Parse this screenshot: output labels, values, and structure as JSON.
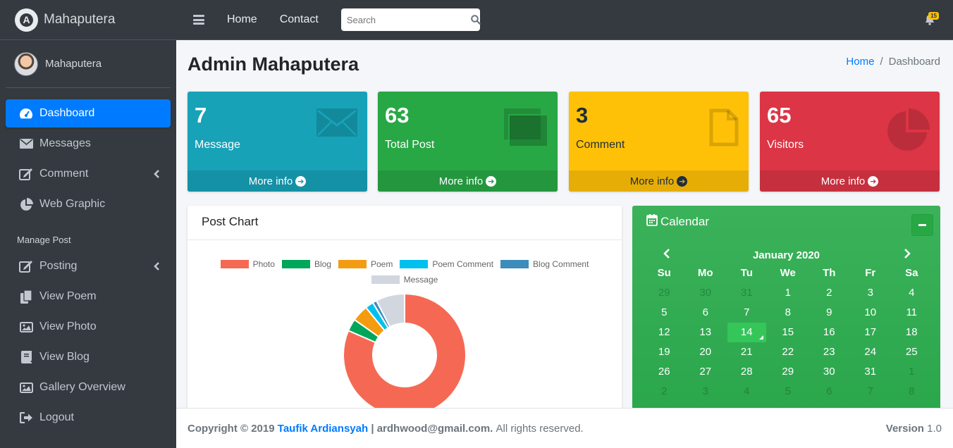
{
  "brand": {
    "name": "Mahaputera",
    "logo_letter": "A"
  },
  "user": {
    "name": "Mahaputera"
  },
  "sidebar": {
    "items": [
      {
        "label": "Dashboard",
        "icon": "dashboard-icon",
        "active": true
      },
      {
        "label": "Messages",
        "icon": "envelope-icon"
      },
      {
        "label": "Comment",
        "icon": "edit-icon",
        "caret": true
      },
      {
        "label": "Web Graphic",
        "icon": "pie-chart-icon"
      }
    ],
    "section_header": "Manage Post",
    "post_items": [
      {
        "label": "Posting",
        "icon": "edit-icon",
        "caret": true
      },
      {
        "label": "View Poem",
        "icon": "copy-icon"
      },
      {
        "label": "View Photo",
        "icon": "image-icon"
      },
      {
        "label": "View Blog",
        "icon": "book-icon"
      },
      {
        "label": "Gallery Overview",
        "icon": "image-icon"
      },
      {
        "label": "Logout",
        "icon": "sign-out-icon"
      }
    ]
  },
  "topbar": {
    "links": [
      "Home",
      "Contact"
    ],
    "search_placeholder": "Search",
    "notification_count": "15"
  },
  "page": {
    "title": "Admin Mahaputera",
    "breadcrumb": [
      "Home",
      "Dashboard"
    ]
  },
  "stats": [
    {
      "value": "7",
      "label": "Message",
      "more": "More info",
      "color": "#17a2b8",
      "icon": "envelope-icon"
    },
    {
      "value": "63",
      "label": "Total Post",
      "more": "More info",
      "color": "#28a745",
      "icon": "copy-icon"
    },
    {
      "value": "3",
      "label": "Comment",
      "more": "More info",
      "color": "#ffc107",
      "icon": "file-icon"
    },
    {
      "value": "65",
      "label": "Visitors",
      "more": "More info",
      "color": "#dc3545",
      "icon": "pie-chart-icon"
    }
  ],
  "post_chart": {
    "title": "Post Chart"
  },
  "chart_data": {
    "type": "pie",
    "title": "",
    "labels": [
      "Photo",
      "Blog",
      "Poem",
      "Poem Comment",
      "Blog Comment",
      "Message"
    ],
    "values": [
      75,
      3,
      4,
      2,
      1,
      7
    ],
    "colors": [
      "#f56954",
      "#00a65a",
      "#f39c12",
      "#00c0ef",
      "#3c8dbc",
      "#d2d6de"
    ],
    "legend_position": "top"
  },
  "calendar": {
    "title": "Calendar",
    "month": "January 2020",
    "weekdays": [
      "Su",
      "Mo",
      "Tu",
      "We",
      "Th",
      "Fr",
      "Sa"
    ],
    "weeks": [
      [
        "29",
        "30",
        "31",
        "1",
        "2",
        "3",
        "4"
      ],
      [
        "5",
        "6",
        "7",
        "8",
        "9",
        "10",
        "11"
      ],
      [
        "12",
        "13",
        "14",
        "15",
        "16",
        "17",
        "18"
      ],
      [
        "19",
        "20",
        "21",
        "22",
        "23",
        "24",
        "25"
      ],
      [
        "26",
        "27",
        "28",
        "29",
        "30",
        "31",
        "1"
      ],
      [
        "2",
        "3",
        "4",
        "5",
        "6",
        "7",
        "8"
      ]
    ],
    "today": "14"
  },
  "footer": {
    "copyright": "Copyright © 2019",
    "author": "Taufik Ardiansyah",
    "separator": "|",
    "email": "ardhwood@gmail.com.",
    "rights": "All rights reserved.",
    "version_label": "Version",
    "version": "1.0"
  }
}
